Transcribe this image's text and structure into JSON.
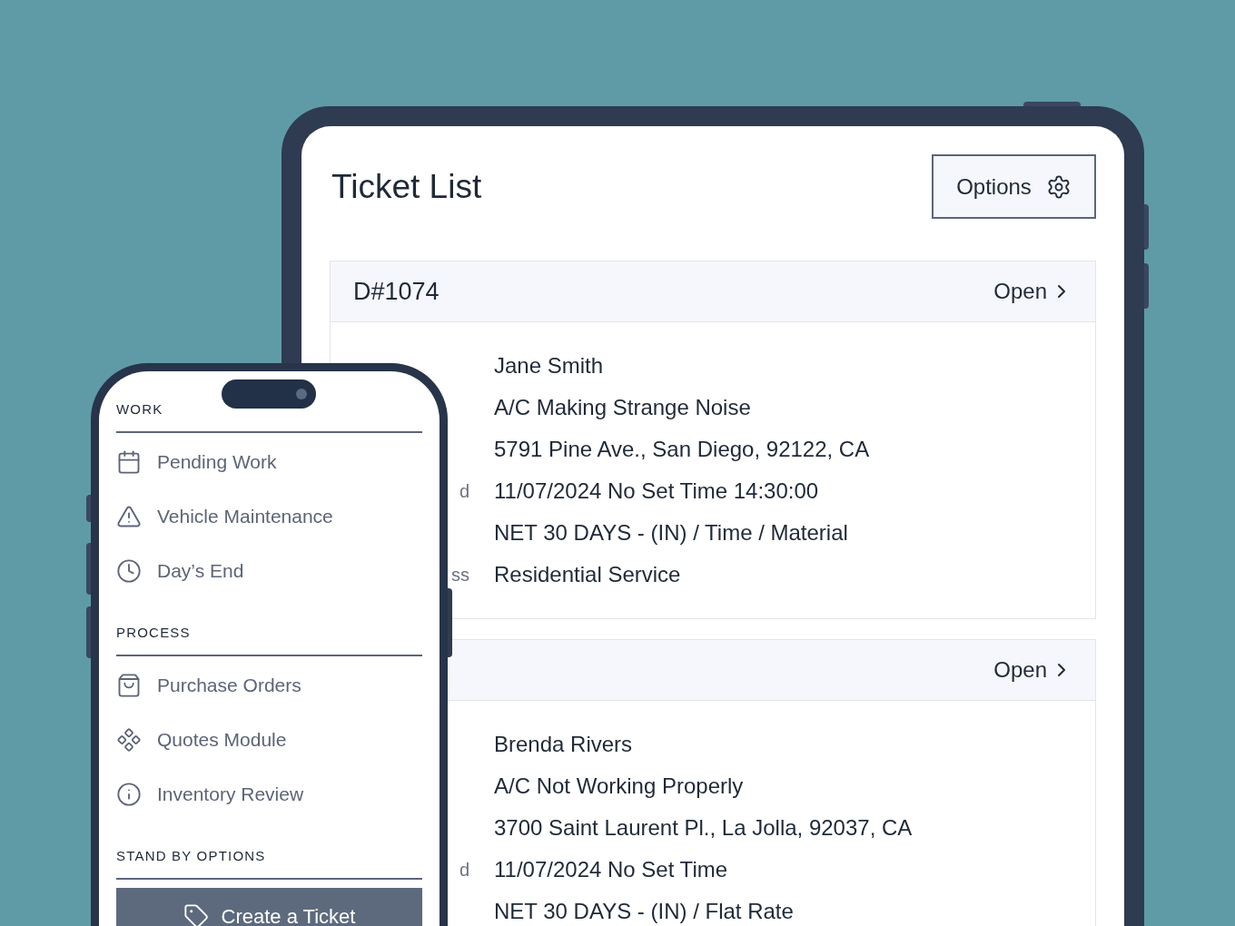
{
  "tablet": {
    "title": "Ticket List",
    "options_button": {
      "label": "Options"
    },
    "tickets": [
      {
        "id": "D#1074",
        "status": "Open",
        "fields": [
          {
            "value": "Jane Smith"
          },
          {
            "value": "A/C Making Strange Noise"
          },
          {
            "value": "5791 Pine Ave., San Diego, 92122, CA"
          },
          {
            "label": "d",
            "value": "11/07/2024 No Set Time 14:30:00"
          },
          {
            "value": "NET 30 DAYS - (IN) / Time / Material"
          },
          {
            "label": "ss",
            "value": "Residential Service"
          }
        ]
      },
      {
        "status": "Open",
        "fields": [
          {
            "value": "Brenda Rivers"
          },
          {
            "value": "A/C Not Working Properly"
          },
          {
            "value": "3700 Saint Laurent Pl., La Jolla, 92037, CA"
          },
          {
            "label": "d",
            "value": "11/07/2024 No Set Time"
          },
          {
            "value": "NET 30 DAYS - (IN) / Flat Rate"
          }
        ]
      }
    ]
  },
  "phone": {
    "sections": [
      {
        "heading": "WORK",
        "items": [
          {
            "label": "Pending Work"
          },
          {
            "label": "Vehicle Maintenance"
          },
          {
            "label": "Day’s End"
          }
        ]
      },
      {
        "heading": "PROCESS",
        "items": [
          {
            "label": "Purchase Orders"
          },
          {
            "label": "Quotes Module"
          },
          {
            "label": "Inventory Review"
          }
        ]
      },
      {
        "heading": "STAND BY OPTIONS",
        "button": {
          "label": "Create a Ticket"
        }
      }
    ]
  }
}
